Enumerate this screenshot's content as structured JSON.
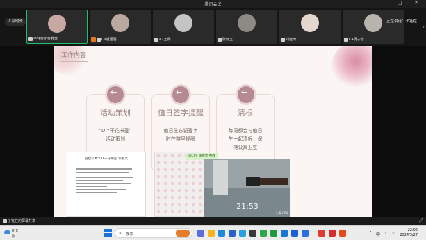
{
  "window": {
    "title": "腾讯会议",
    "controls": [
      "—",
      "□",
      "✕"
    ]
  },
  "gallery": {
    "meeting_pill": "入会时长",
    "participants": [
      {
        "name": "子钰在正在共享",
        "active": true,
        "avatar_color": "#c8a9a2"
      },
      {
        "name": "C9姐狸羽",
        "active": false,
        "hand_raised": true,
        "avatar_color": "#bba9a0"
      },
      {
        "name": "A1王霖",
        "active": false,
        "avatar_color": "#c4c4c4"
      },
      {
        "name": "张晓玉",
        "active": false,
        "avatar_color": "#8d8a84"
      },
      {
        "name": "刘佳琦",
        "active": false,
        "avatar_color": "#e3d7cf"
      },
      {
        "name": "C4杨子怡",
        "active": false,
        "avatar_color": "#b9b3ad"
      }
    ],
    "speaking_label": "正在讲话：子钰在"
  },
  "slide": {
    "section_title": "工作内容",
    "cards": [
      {
        "title": "活动策划",
        "desc_lines": [
          "“DIY干花书签”",
          "活动策划"
        ]
      },
      {
        "title": "值日签字提醒",
        "desc_lines": [
          "值日生忘记签字",
          "时在群里提醒"
        ]
      },
      {
        "title": "清根",
        "desc_lines": [
          "每周都会与值日",
          "生一起清根，保",
          "持公寓卫生"
        ]
      }
    ],
    "thumb_title": "首登公寓“DIY干花书签”策划案",
    "chat_banner": "@C09 张依萱 整改",
    "camera": {
      "time": "21:53",
      "label": "公寓 C09"
    }
  },
  "sharebar": {
    "label": "子钰在的屏幕共享"
  },
  "taskbar": {
    "weather_temp": "8°C",
    "weather_cond": "阴",
    "search_placeholder": "搜索",
    "clock_time": "22:02",
    "clock_date": "2024/3/27"
  }
}
